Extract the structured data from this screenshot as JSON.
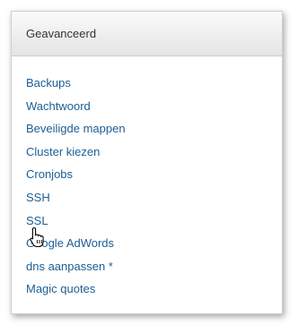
{
  "panel": {
    "title": "Geavanceerd"
  },
  "menu": {
    "items": [
      {
        "label": "Backups"
      },
      {
        "label": "Wachtwoord"
      },
      {
        "label": "Beveiligde mappen"
      },
      {
        "label": "Cluster kiezen"
      },
      {
        "label": "Cronjobs"
      },
      {
        "label": "SSH"
      },
      {
        "label": "SSL"
      },
      {
        "label": "Google AdWords"
      },
      {
        "label": "dns aanpassen *"
      },
      {
        "label": "Magic quotes"
      }
    ]
  },
  "colors": {
    "link": "#1c5e95",
    "header_text": "#333333",
    "border": "#cfcfcf"
  },
  "icons": {
    "cursor": "hand-pointer-icon"
  }
}
